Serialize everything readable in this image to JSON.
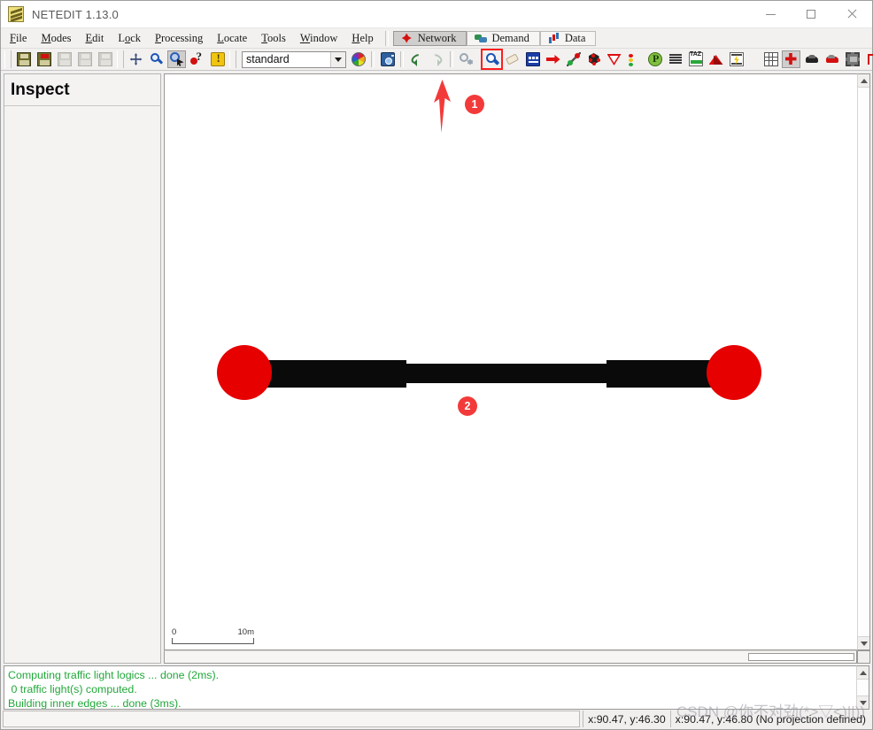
{
  "window": {
    "title": "NETEDIT 1.13.0",
    "app_icon": "netedit-logo-icon",
    "minimize": "—",
    "maximize": "□",
    "close": "✕"
  },
  "menubar": {
    "items": [
      {
        "label": "File",
        "mnemonic": "F"
      },
      {
        "label": "Modes",
        "mnemonic": "M"
      },
      {
        "label": "Edit",
        "mnemonic": "E"
      },
      {
        "label": "Lock",
        "mnemonic": "L"
      },
      {
        "label": "Processing",
        "mnemonic": "P"
      },
      {
        "label": "Locate",
        "mnemonic": "L"
      },
      {
        "label": "Tools",
        "mnemonic": "T"
      },
      {
        "label": "Window",
        "mnemonic": "W"
      },
      {
        "label": "Help",
        "mnemonic": "H"
      }
    ],
    "supertabs": [
      {
        "label": "Network",
        "icon": "network-diamond-icon",
        "active": true
      },
      {
        "label": "Demand",
        "icon": "demand-vehicles-icon",
        "active": false
      },
      {
        "label": "Data",
        "icon": "data-barchart-icon",
        "active": false
      }
    ]
  },
  "toolbar": {
    "groups": [
      {
        "name": "file-group",
        "buttons": [
          {
            "name": "save-network-button",
            "icon": "floppy-save-icon",
            "state": "enabled"
          },
          {
            "name": "save-as-network-button",
            "icon": "floppy-save-red-icon",
            "state": "enabled"
          },
          {
            "name": "save-plain-xml-button",
            "icon": "floppy-dim-icon",
            "state": "disabled"
          },
          {
            "name": "save-joined-junctions-button",
            "icon": "floppy-dim-icon",
            "state": "disabled"
          },
          {
            "name": "save-tls-programs-button",
            "icon": "floppy-dim-icon",
            "state": "disabled"
          }
        ]
      },
      {
        "name": "navigation-group",
        "buttons": [
          {
            "name": "recenter-view-button",
            "icon": "move-arrows-icon",
            "state": "enabled"
          },
          {
            "name": "zoom-style-button",
            "icon": "magnifier-icon",
            "state": "enabled"
          },
          {
            "name": "zoom-selection-button",
            "icon": "zoom-select-icon",
            "state": "pressed"
          },
          {
            "name": "help-button",
            "icon": "question-help-icon",
            "state": "enabled"
          },
          {
            "name": "info-button",
            "icon": "lightbulb-icon",
            "state": "enabled"
          }
        ]
      },
      {
        "name": "scheme-group",
        "combo": {
          "name": "color-scheme-combo",
          "value": "standard"
        },
        "buttons": [
          {
            "name": "edit-visualisation-button",
            "icon": "color-wheel-icon",
            "state": "enabled"
          },
          {
            "name": "make-snapshot-button",
            "icon": "camera-icon",
            "state": "enabled"
          }
        ]
      },
      {
        "name": "undo-group",
        "buttons": [
          {
            "name": "undo-button",
            "icon": "undo-arrow-icon",
            "state": "enabled"
          },
          {
            "name": "redo-button",
            "icon": "redo-arrow-icon",
            "state": "disabled"
          },
          {
            "name": "compute-junctions-button",
            "icon": "compute-gear-icon",
            "state": "disabled"
          }
        ]
      },
      {
        "name": "network-modes-group",
        "buttons": [
          {
            "name": "inspect-mode-button",
            "icon": "magnifier-big-icon",
            "state": "highlighted"
          },
          {
            "name": "delete-mode-button",
            "icon": "eraser-icon",
            "state": "enabled"
          },
          {
            "name": "select-mode-button",
            "icon": "lane-select-icon",
            "state": "enabled"
          },
          {
            "name": "move-mode-button",
            "icon": "red-arrow-icon",
            "state": "enabled"
          },
          {
            "name": "create-edge-mode-button",
            "icon": "edge-connect-icon",
            "state": "enabled"
          },
          {
            "name": "traffic-light-mode-button",
            "icon": "junction-black-icon",
            "state": "enabled"
          },
          {
            "name": "connection-mode-button",
            "icon": "yield-triangle-icon",
            "state": "enabled"
          },
          {
            "name": "tls-mode-button",
            "icon": "traffic-light-icon",
            "state": "enabled"
          },
          {
            "name": "additional-mode-button",
            "icon": "parking-green-icon",
            "state": "enabled"
          },
          {
            "name": "crossing-mode-button",
            "icon": "crossing-stripes-icon",
            "state": "enabled"
          },
          {
            "name": "taz-mode-button",
            "icon": "taz-icon",
            "state": "enabled"
          },
          {
            "name": "shape-mode-button",
            "icon": "polygon-shape-icon",
            "state": "enabled"
          },
          {
            "name": "wire-mode-button",
            "icon": "lightning-wire-icon",
            "state": "enabled"
          }
        ]
      },
      {
        "name": "toggle-group",
        "buttons": [
          {
            "name": "toggle-grid-button",
            "icon": "grid-icon",
            "state": "enabled"
          },
          {
            "name": "draw-junction-shape-button",
            "icon": "junction-cross-icon",
            "state": "pressed"
          },
          {
            "name": "show-bubbles-button",
            "icon": "vehicle-black-icon",
            "state": "enabled"
          },
          {
            "name": "move-elevation-button",
            "icon": "vehicle-red-icon",
            "state": "enabled"
          },
          {
            "name": "show-connections-button",
            "icon": "dashed-select-icon",
            "state": "enabled"
          },
          {
            "name": "select-edges-button",
            "icon": "lane-arrow-icon",
            "state": "enabled"
          },
          {
            "name": "show-demand-elements-button",
            "icon": "list-lines-icon",
            "state": "enabled"
          }
        ]
      }
    ]
  },
  "left_panel": {
    "header": "Inspect"
  },
  "canvas": {
    "scalebar": {
      "start": "0",
      "end": "10m"
    },
    "elements": {
      "left_node": "junction-node-left",
      "right_node": "junction-node-right",
      "edge": "road-edge"
    },
    "annotations": [
      {
        "name": "annotation-arrow-1",
        "type": "arrow",
        "target": "inspect-mode-button"
      },
      {
        "name": "annotation-badge-1",
        "type": "badge",
        "label": "1"
      },
      {
        "name": "annotation-badge-2",
        "type": "badge",
        "label": "2"
      }
    ]
  },
  "messages": {
    "lines": [
      "Computing traffic light logics ... done (2ms).",
      " 0 traffic light(s) computed.",
      "Building inner edges ... done (3ms)."
    ],
    "color": "#22a83a"
  },
  "statusbar": {
    "cursor_position": "x:90.47, y:46.30",
    "network_position": "x:90.47, y:46.80 (No projection defined)"
  },
  "watermark": {
    "text": "CSDN @你不对劲(*>▽<)||))"
  },
  "colors": {
    "node": "#e60000",
    "edge": "#0a0a0a",
    "message": "#22a83a",
    "annotation": "#f33a3a",
    "accent": "#d31010"
  }
}
